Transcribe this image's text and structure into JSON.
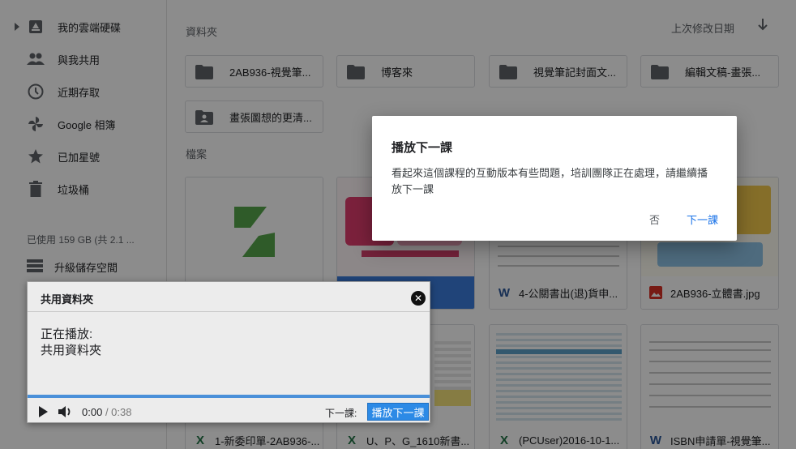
{
  "sidebar": {
    "items": [
      {
        "label": "我的雲端硬碟",
        "icon": "drive-icon"
      },
      {
        "label": "與我共用",
        "icon": "people-icon"
      },
      {
        "label": "近期存取",
        "icon": "clock-icon"
      },
      {
        "label": "Google 相簿",
        "icon": "pinwheel-icon"
      },
      {
        "label": "已加星號",
        "icon": "star-icon"
      },
      {
        "label": "垃圾桶",
        "icon": "trash-icon"
      }
    ],
    "storage": "已使用 159 GB (共 2.1 ...",
    "upgrade": "升級儲存空間"
  },
  "main": {
    "folders_label": "資料夾",
    "files_label": "檔案",
    "sort_label": "上次修改日期",
    "folders": [
      {
        "name": "2AB936-視覺筆..."
      },
      {
        "name": "博客來"
      },
      {
        "name": "視覺筆記封面文..."
      },
      {
        "name": "編輯文稿-畫張..."
      },
      {
        "name": "畫張圖想的更清..."
      }
    ],
    "files": [
      {
        "name": "",
        "type": "logo"
      },
      {
        "name": "",
        "type": "book"
      },
      {
        "name": "",
        "type": "sheet"
      },
      {
        "name": "",
        "type": "book2"
      },
      {
        "name": "4-公關書出(退)貨申...",
        "type": "word"
      },
      {
        "name": "2AB936-立體書.jpg",
        "type": "image"
      },
      {
        "name": "1-新委印單-2AB936-...",
        "type": "excel"
      },
      {
        "name": "U、P、G_1610新書...",
        "type": "excel"
      },
      {
        "name": "(PCUser)2016-10-1...",
        "type": "excel"
      },
      {
        "name": "ISBN申請單-視覺筆...",
        "type": "word"
      }
    ]
  },
  "dialog": {
    "title": "播放下一課",
    "body": "看起來這個課程的互動版本有些問題，培訓團隊正在處理，請繼續播放下一課",
    "no": "否",
    "next": "下一課"
  },
  "player": {
    "title": "共用資料夾",
    "now_playing_label": "正在播放:",
    "now_playing": "共用資料夾",
    "time_current": "0:00",
    "time_total": "/ 0:38",
    "next_label": "下一課:",
    "next_button": "播放下一課",
    "progress": 0.0
  },
  "colors": {
    "accent": "#1a73e8",
    "word": "#2b579a",
    "excel": "#217346",
    "image": "#d93025",
    "logo_green": "#56a64b"
  }
}
